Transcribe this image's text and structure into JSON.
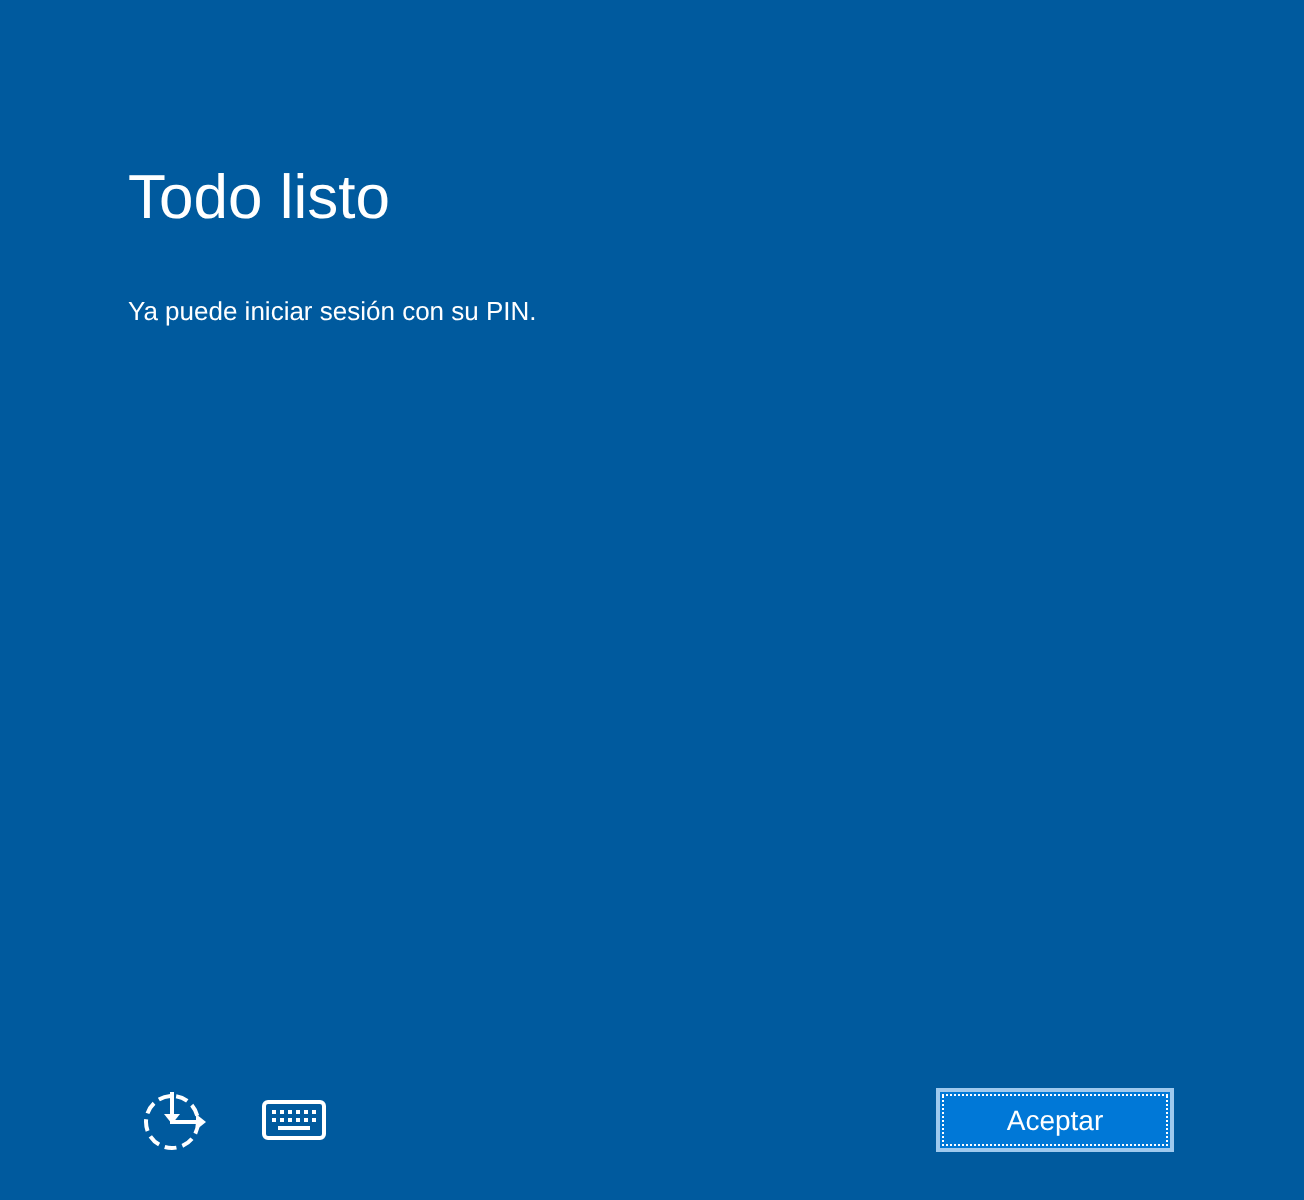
{
  "title": "Todo listo",
  "message": "Ya puede iniciar sesión con su PIN.",
  "button": {
    "label": "Aceptar",
    "focused": true
  }
}
